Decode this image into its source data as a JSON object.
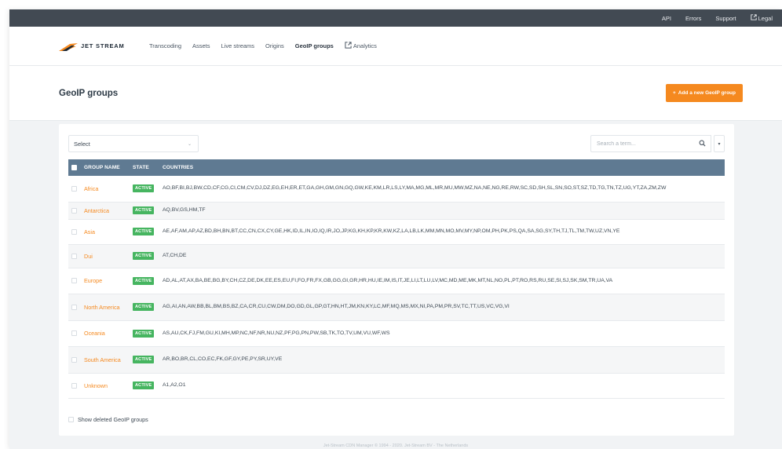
{
  "topbar": {
    "links": [
      {
        "label": "API"
      },
      {
        "label": "Errors"
      },
      {
        "label": "Support"
      },
      {
        "label": "Legal"
      }
    ]
  },
  "brand": {
    "name": "JET STREAM"
  },
  "nav": {
    "items": [
      {
        "label": "Transcoding"
      },
      {
        "label": "Assets"
      },
      {
        "label": "Live streams"
      },
      {
        "label": "Origins"
      },
      {
        "label": "GeoIP groups",
        "active": true
      },
      {
        "label": "Analytics"
      }
    ]
  },
  "header": {
    "title": "GeoIP groups",
    "add_button_label": "Add a new GeoIP group"
  },
  "filters": {
    "select_value": "Select",
    "search_placeholder": "Search a term..."
  },
  "table": {
    "columns": {
      "name": "GROUP NAME",
      "state": "STATE",
      "countries": "COUNTRIES"
    },
    "rows": [
      {
        "name": "Africa",
        "state": "ACTIVE",
        "countries": "AO,BF,BI,BJ,BW,CD,CF,CG,CI,CM,CV,DJ,DZ,EG,EH,ER,ET,GA,GH,GM,GN,GQ,GW,KE,KM,LR,LS,LY,MA,MG,ML,MR,MU,MW,MZ,NA,NE,NG,RE,RW,SC,SD,SH,SL,SN,SO,ST,SZ,TD,TG,TN,TZ,UG,YT,ZA,ZM,ZW"
      },
      {
        "name": "Antarctica",
        "state": "ACTIVE",
        "countries": "AQ,BV,GS,HM,TF"
      },
      {
        "name": "Asia",
        "state": "ACTIVE",
        "countries": "AE,AF,AM,AP,AZ,BD,BH,BN,BT,CC,CN,CX,CY,GE,HK,ID,IL,IN,IO,IQ,IR,JO,JP,KG,KH,KP,KR,KW,KZ,LA,LB,LK,MM,MN,MO,MV,MY,NP,OM,PH,PK,PS,QA,SA,SG,SY,TH,TJ,TL,TM,TW,UZ,VN,YE"
      },
      {
        "name": "Dui",
        "state": "ACTIVE",
        "countries": "AT,CH,DE"
      },
      {
        "name": "Europe",
        "state": "ACTIVE",
        "countries": "AD,AL,AT,AX,BA,BE,BG,BY,CH,CZ,DE,DK,EE,ES,EU,FI,FO,FR,FX,GB,GG,GI,GR,HR,HU,IE,IM,IS,IT,JE,LI,LT,LU,LV,MC,MD,ME,MK,MT,NL,NO,PL,PT,RO,RS,RU,SE,SI,SJ,SK,SM,TR,UA,VA"
      },
      {
        "name": "North America",
        "state": "ACTIVE",
        "countries": "AG,AI,AN,AW,BB,BL,BM,BS,BZ,CA,CR,CU,CW,DM,DO,GD,GL,GP,GT,HN,HT,JM,KN,KY,LC,MF,MQ,MS,MX,NI,PA,PM,PR,SV,TC,TT,US,VC,VG,VI"
      },
      {
        "name": "Oceania",
        "state": "ACTIVE",
        "countries": "AS,AU,CK,FJ,FM,GU,KI,MH,MP,NC,NF,NR,NU,NZ,PF,PG,PN,PW,SB,TK,TO,TV,UM,VU,WF,WS"
      },
      {
        "name": "South America",
        "state": "ACTIVE",
        "countries": "AR,BO,BR,CL,CO,EC,FK,GF,GY,PE,PY,SR,UY,VE"
      },
      {
        "name": "Unknown",
        "state": "ACTIVE",
        "countries": "A1,A2,O1"
      }
    ]
  },
  "show_deleted_label": "Show deleted GeoIP groups",
  "footer": {
    "text": "Jet-Stream CDN Manager © 1994 - 2020. Jet-Stream BV - The Netherlands"
  },
  "colors": {
    "accent": "#f5891f",
    "topbar_bg": "#424a53",
    "table_header_bg": "#5f7a92",
    "active_badge": "#46b560"
  }
}
